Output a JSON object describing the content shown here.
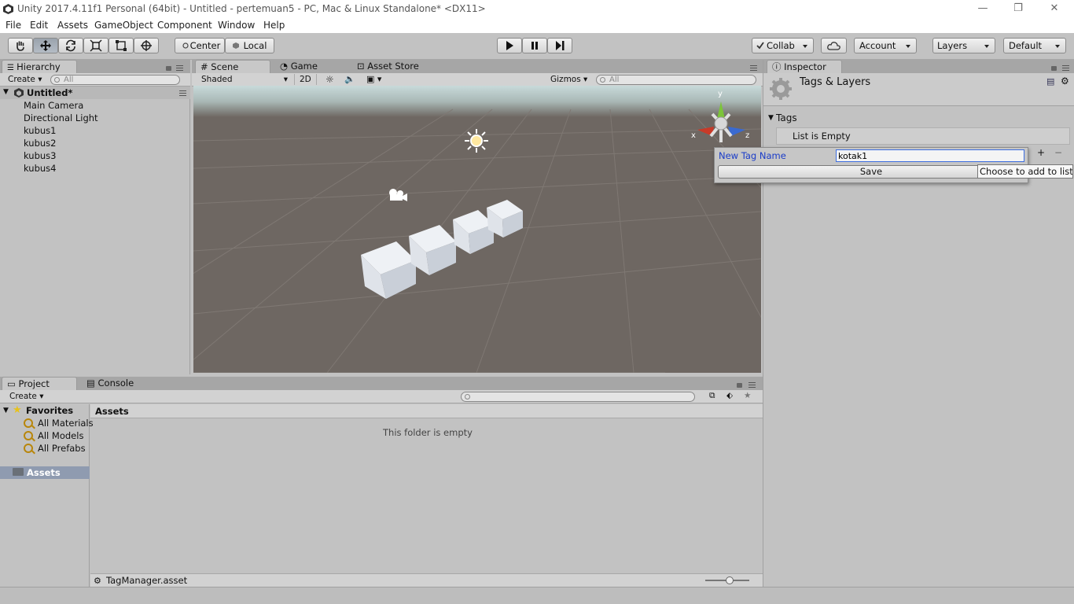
{
  "window": {
    "title": "Unity 2017.4.11f1 Personal (64bit) - Untitled - pertemuan5 - PC, Mac & Linux Standalone* <DX11>",
    "minimize": "—",
    "restore": "❐",
    "close": "✕"
  },
  "menu": [
    "File",
    "Edit",
    "Assets",
    "GameObject",
    "Component",
    "Window",
    "Help"
  ],
  "toolbar": {
    "pivot": "Center",
    "space": "Local",
    "collab": "Collab",
    "account": "Account",
    "layers": "Layers",
    "layout": "Default"
  },
  "hierarchy": {
    "tab": "Hierarchy",
    "create": "Create",
    "search_placeholder": "All",
    "scene": "Untitled*",
    "items": [
      "Main Camera",
      "Directional Light",
      "kubus1",
      "kubus2",
      "kubus3",
      "kubus4"
    ]
  },
  "scene": {
    "tabs": [
      "Scene",
      "Game",
      "Asset Store"
    ],
    "shading": "Shaded",
    "mode2d": "2D",
    "gizmos": "Gizmos",
    "search_placeholder": "All",
    "axis_y": "y",
    "axis_x": "x",
    "axis_z": "z"
  },
  "inspector": {
    "tab": "Inspector",
    "header": "Tags & Layers",
    "tags_section": "Tags",
    "list_empty": "List is Empty",
    "add": "+",
    "remove": "−",
    "popup": {
      "label": "New Tag Name",
      "value": "kotak1",
      "save": "Save",
      "tooltip": "Choose to add to list"
    }
  },
  "project": {
    "tabs": [
      "Project",
      "Console"
    ],
    "create": "Create",
    "favorites": "Favorites",
    "favorite_items": [
      "All Materials",
      "All Models",
      "All Prefabs"
    ],
    "assets_label": "Assets",
    "assets_header": "Assets",
    "empty_message": "This folder is empty",
    "selected_file": "TagManager.asset"
  },
  "colors": {
    "accent_blue": "#1a3cc8",
    "scene_ground": "#6e6762",
    "selection": "#8f9bb0"
  }
}
